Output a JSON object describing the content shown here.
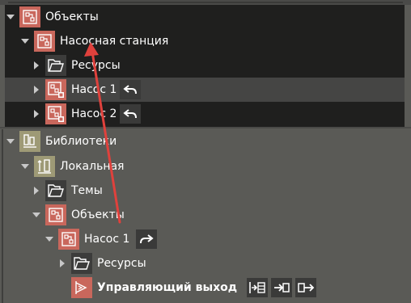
{
  "colors": {
    "accent_red": "#c9675c",
    "library_olive": "#9e9a76",
    "annotation_arrow": "#e0413c"
  },
  "tree_top": {
    "root": {
      "label": "Объекты",
      "icon": "object-group-icon"
    },
    "project": {
      "label": "Насосная станция",
      "icon": "object-group-icon"
    },
    "resources": {
      "label": "Ресурсы",
      "icon": "folder-icon"
    },
    "pump1": {
      "label": "Насос 1",
      "icon": "object-instance-icon",
      "action_icon": "undo-arrow-icon"
    },
    "pump2": {
      "label": "Насос 2",
      "icon": "object-instance-icon",
      "action_icon": "undo-arrow-icon"
    }
  },
  "tree_bottom": {
    "libraries": {
      "label": "Библиотеки",
      "icon": "libraries-icon"
    },
    "local": {
      "label": "Локальная",
      "icon": "local-library-icon"
    },
    "themes": {
      "label": "Темы",
      "icon": "folder-icon"
    },
    "objects": {
      "label": "Объекты",
      "icon": "object-group-icon"
    },
    "pump1": {
      "label": "Насос 1",
      "icon": "object-group-icon",
      "action_icon": "redo-arrow-icon"
    },
    "resources": {
      "label": "Ресурсы",
      "icon": "folder-icon"
    },
    "control_output": {
      "label": "Управляющий выход",
      "icon": "control-output-icon",
      "buttons": [
        "insert-into-list-icon",
        "input-signal-icon",
        "output-signal-icon"
      ]
    }
  }
}
